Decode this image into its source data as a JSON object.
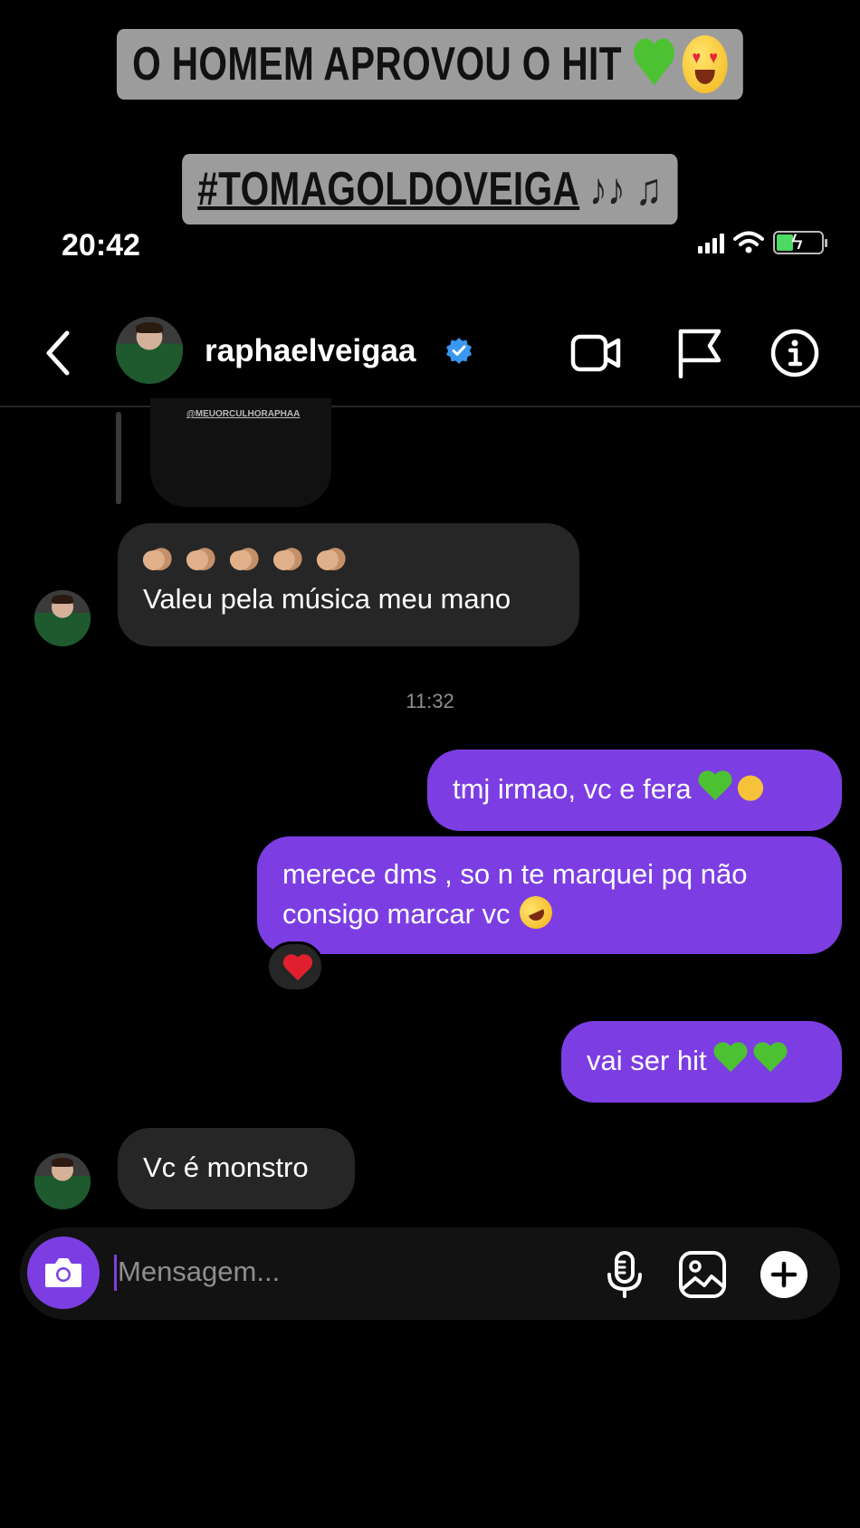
{
  "story": {
    "caption_1": "O HOMEM APROVOU O HIT",
    "caption_2": "#TOMAGOLDOVEIGA",
    "caption_2_notes": "♪♪ ♫"
  },
  "status_bar": {
    "time": "20:42"
  },
  "header": {
    "username": "raphaelveigaa"
  },
  "shared_post": {
    "handle": "@MEUORCULHORAPHAA"
  },
  "messages": {
    "m1_text": "Valeu pela música meu mano",
    "timestamp": "11:32",
    "m2_text": "tmj irmao, vc e fera",
    "m3_line1": "merece dms , so n te marquei pq não",
    "m3_line2": "consigo marcar vc",
    "m4_text": "vai ser hit",
    "m5_text": "Vc é monstro"
  },
  "composer": {
    "placeholder": "Mensagem..."
  },
  "colors": {
    "accent": "#7c3ee3",
    "incoming_bubble": "#262626",
    "background": "#000000",
    "caption_bg": "#9c9c9c"
  },
  "icons": [
    "back-chevron-icon",
    "verified-badge-icon",
    "video-call-icon",
    "flag-icon",
    "info-icon",
    "camera-icon",
    "microphone-icon",
    "gallery-icon",
    "plus-icon"
  ]
}
